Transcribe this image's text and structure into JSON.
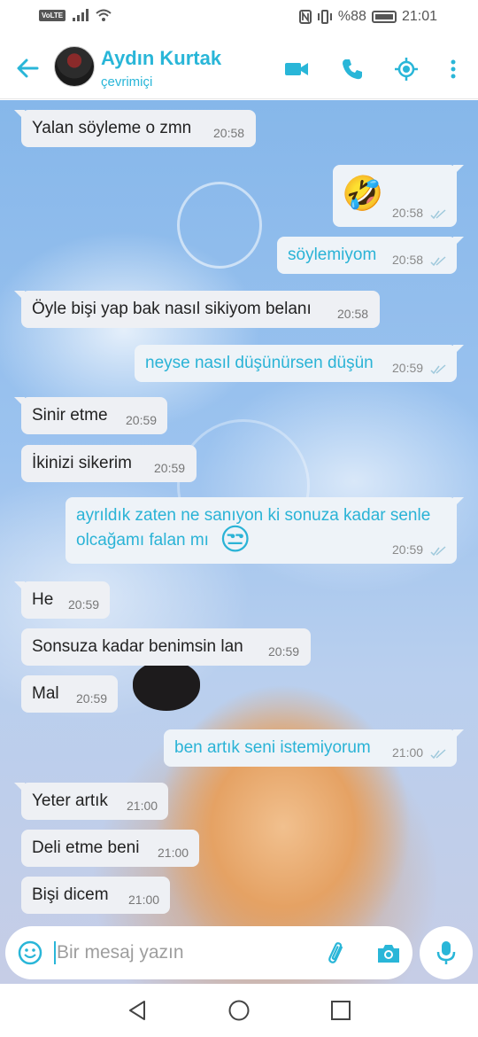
{
  "status_bar": {
    "volte": "VoLTE",
    "battery_text": "%88",
    "time": "21:01"
  },
  "header": {
    "contact_name": "Aydın Kurtak",
    "contact_status": "çevrimiçi"
  },
  "messages": [
    {
      "dir": "in",
      "text": "Yalan söyleme o zmn",
      "time": "20:58"
    },
    {
      "dir": "out",
      "emoji": "rolling-on-floor-laughing",
      "text": "🤣",
      "time": "20:58"
    },
    {
      "dir": "out",
      "text": "söylemiyom",
      "time": "20:58"
    },
    {
      "dir": "in",
      "text": "Öyle bişi yap bak nasıl sikiyom belanı",
      "time": "20:58"
    },
    {
      "dir": "out",
      "text": "neyse nasıl düşünürsen düşün",
      "time": "20:59"
    },
    {
      "dir": "in",
      "text": "Sinir etme",
      "time": "20:59"
    },
    {
      "dir": "in",
      "text": "İkinizi sikerim",
      "time": "20:59"
    },
    {
      "dir": "out",
      "line1": "ayrıldık zaten ne sanıyon ki sonuza kadar senle",
      "line2": "olcağamı falan mı",
      "emoji": "😒",
      "time": "20:59"
    },
    {
      "dir": "in",
      "text": "He",
      "time": "20:59"
    },
    {
      "dir": "in",
      "text": "Sonsuza kadar benimsin lan",
      "time": "20:59"
    },
    {
      "dir": "in",
      "text": "Mal",
      "time": "20:59"
    },
    {
      "dir": "out",
      "text": "ben artık seni istemiyorum",
      "time": "21:00"
    },
    {
      "dir": "in",
      "text": "Yeter artık",
      "time": "21:00"
    },
    {
      "dir": "in",
      "text": "Deli etme beni",
      "time": "21:00"
    },
    {
      "dir": "in",
      "text": "Bişi dicem",
      "time": "21:00"
    }
  ],
  "input": {
    "placeholder": "Bir mesaj yazın"
  },
  "colors": {
    "accent": "#29b6d8",
    "incoming_bubble": "#eef0f4",
    "outgoing_bubble": "#eef3f8"
  }
}
